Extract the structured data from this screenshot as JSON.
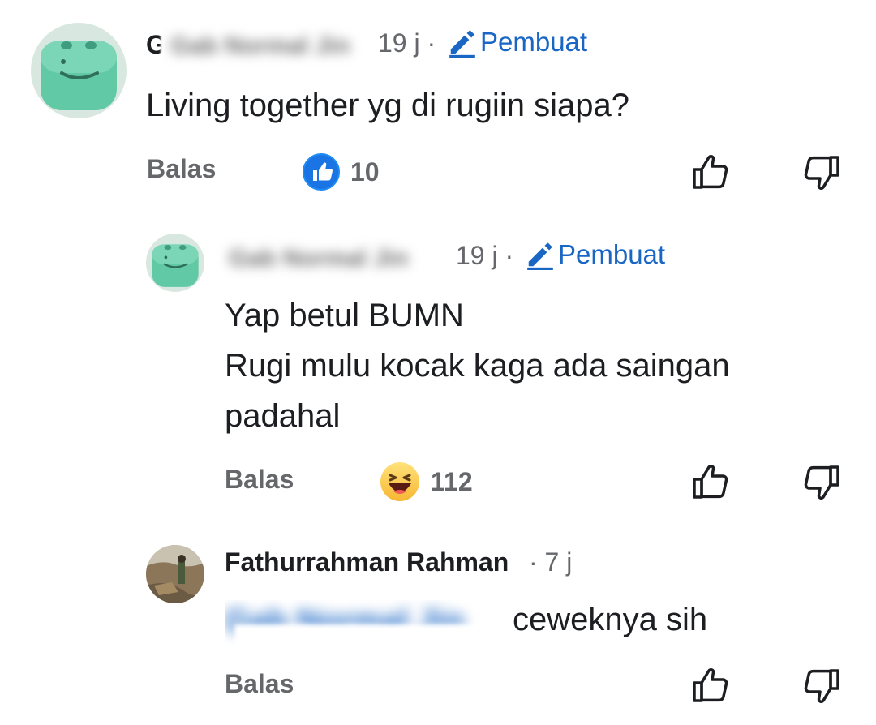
{
  "comments": [
    {
      "author_initial": "G",
      "author_blurred": "Gab Normal Jin",
      "time": "19 j",
      "separator": "·",
      "badge": "Pembuat",
      "text": "Living together yg di rugiin siapa?",
      "reply_label": "Balas",
      "reaction": {
        "type": "like",
        "count": "10"
      }
    },
    {
      "author_blurred": "Gab Normal Jin",
      "time": "19 j",
      "separator": "·",
      "badge": "Pembuat",
      "text_lines": [
        "Yap betul BUMN",
        "Rugi mulu kocak kaga ada saingan",
        "padahal"
      ],
      "reply_label": "Balas",
      "reaction": {
        "type": "haha",
        "count": "112"
      }
    },
    {
      "author": "Fathurrahman Rahman",
      "time": "7 j",
      "separator": "·",
      "mention_blurred": "Gab Normal Jin",
      "text": "ceweknya sih",
      "reply_label": "Balas"
    }
  ],
  "icons": {
    "like": "thumbs-up-outline-icon",
    "dislike": "thumbs-down-outline-icon",
    "badge": "pencil-icon",
    "reaction_like": "like-reaction-icon",
    "reaction_haha": "haha-reaction-icon"
  },
  "colors": {
    "accent": "#1a66c4",
    "muted": "#65676b",
    "text": "#1c1e21"
  }
}
